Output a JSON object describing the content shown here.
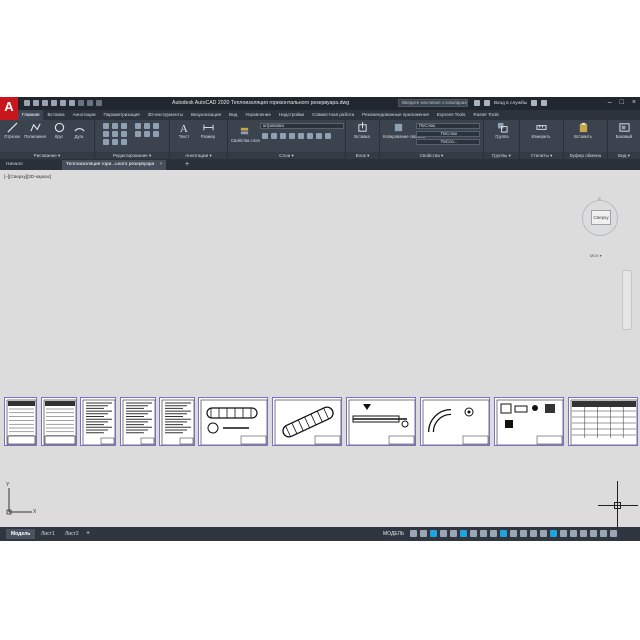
{
  "app": {
    "logo": "A",
    "title": "Autodesk AutoCAD 2020   Теплоизоляция горизонтального резервуара.dwg",
    "search_placeholder": "Введите ключевое слово/фразу",
    "sign_in": "Вход в службы"
  },
  "ribbon_tabs": [
    "Главная",
    "Вставка",
    "Аннотации",
    "Параметризация",
    "3D-инструменты",
    "Визуализация",
    "Вид",
    "Управление",
    "Надстройки",
    "Совместная работа",
    "Рекомендованные приложения",
    "Express Tools",
    "Raster Tools"
  ],
  "ribbon": {
    "draw": {
      "title": "Рисование ▾",
      "line": "Отрезок",
      "polyline": "Полилиния",
      "circle": "Круг",
      "arc": "Дуга"
    },
    "modify": {
      "title": "Редактирование ▾"
    },
    "annotation": {
      "title": "Аннотации ▾",
      "text": "Текст",
      "dimension": "Размер"
    },
    "layers": {
      "title": "Слои ▾",
      "layer_properties": "Свойства слоя",
      "current_layer": "штриховка"
    },
    "block": {
      "title": "Блок ▾",
      "insert": "Вставка"
    },
    "properties": {
      "title": "Свойства ▾",
      "match": "Копирование свойств",
      "bylayer1": "ПоСлою",
      "bylayer2": "ПоСлою",
      "bylayer3": "ПоСло..."
    },
    "groups": {
      "title": "Группы ▾",
      "group": "Группа"
    },
    "utilities": {
      "title": "Утилиты ▾",
      "measure": "Измерить"
    },
    "clipboard": {
      "title": "Буфер обмена",
      "paste": "Вставить"
    },
    "view": {
      "title": "Вид ▾",
      "base": "Базовый"
    }
  },
  "doc_tabs": {
    "start": "Начало",
    "active": "Теплоизоляция гори...ьного резервуара",
    "close": "×",
    "add": "+"
  },
  "viewport": {
    "label": "[−][Сверху][2D-каркас]",
    "viewcube_face": "Сверху",
    "viewcube_north": "С",
    "wcs": "МСК ▾"
  },
  "ucs": {
    "x": "X",
    "y": "Y"
  },
  "layout_tabs": {
    "model": "Модель",
    "sheet1": "Лист1",
    "sheet2": "Лист2",
    "add": "+"
  },
  "status": {
    "model": "МОДЕЛЬ",
    "scale": "1:1"
  },
  "colors": {
    "title_bg": "#22272f",
    "ribbon_bg": "#3b434e",
    "canvas_bg": "#dcdcdc",
    "logo": "#c8161d",
    "sheet_border": "#7d6fc6",
    "accent": "#1fa3e0"
  }
}
